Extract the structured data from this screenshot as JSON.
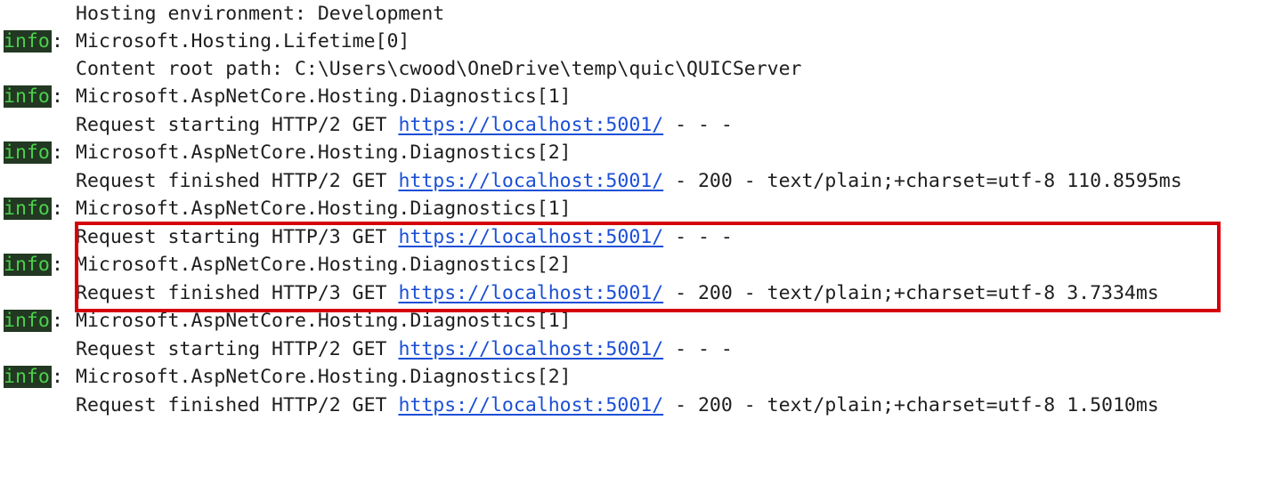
{
  "console": {
    "badge_label": "info",
    "colon": ":",
    "dash3": " - - -",
    "dash200": " - 200 - text/plain;+charset=utf-8 ",
    "lines": {
      "l0": "Hosting environment: Development",
      "l1": "Microsoft.Hosting.Lifetime[0]",
      "l2": "Content root path: C:\\Users\\cwood\\OneDrive\\temp\\quic\\QUICServer",
      "l3": "Microsoft.AspNetCore.Hosting.Diagnostics[1]",
      "l4_prefix": "Request starting HTTP/2 GET ",
      "l5": "Microsoft.AspNetCore.Hosting.Diagnostics[2]",
      "l6_prefix": "Request finished HTTP/2 GET ",
      "l6_time": "110.8595ms",
      "l7": "Microsoft.AspNetCore.Hosting.Diagnostics[1]",
      "l8_prefix": "Request starting HTTP/3 GET ",
      "l9": "Microsoft.AspNetCore.Hosting.Diagnostics[2]",
      "l10_prefix": "Request finished HTTP/3 GET ",
      "l10_time": "3.7334ms",
      "l11": "Microsoft.AspNetCore.Hosting.Diagnostics[1]",
      "l12_prefix": "Request starting HTTP/2 GET ",
      "l13": "Microsoft.AspNetCore.Hosting.Diagnostics[2]",
      "l14_prefix": "Request finished HTTP/2 GET ",
      "l14_time": "1.5010ms"
    },
    "url": "https://localhost:5001/"
  },
  "colors": {
    "badge_bg": "#223822",
    "badge_fg": "#4cd04c",
    "link": "#1a4fd6",
    "highlight_border": "#d4000a"
  }
}
